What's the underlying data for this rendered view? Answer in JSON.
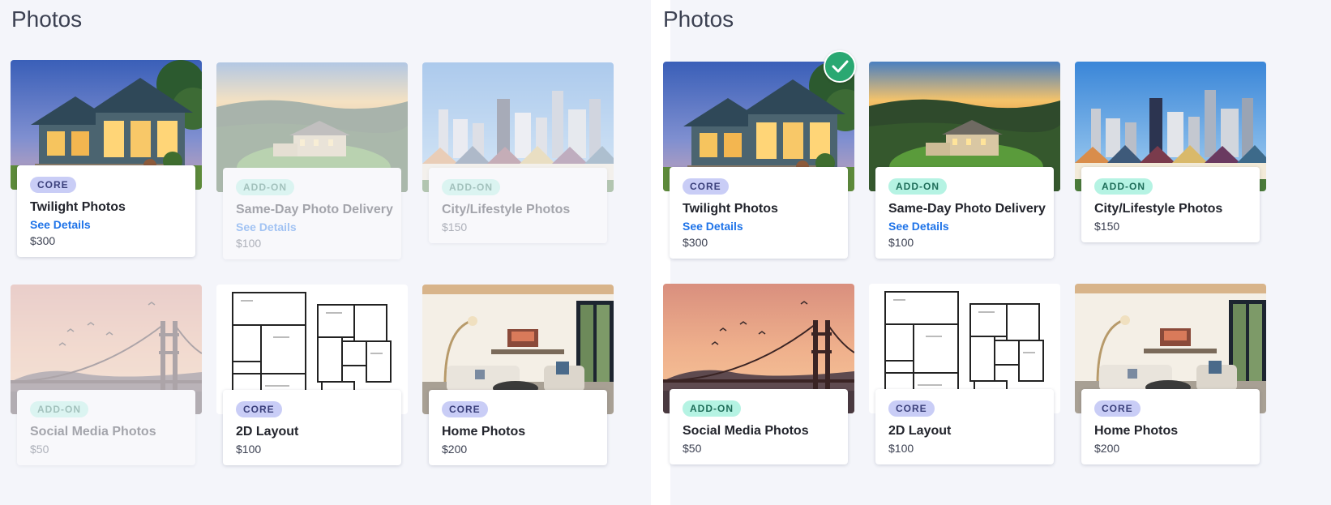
{
  "panels": [
    {
      "title": "Photos",
      "tiles": [
        {
          "badge": "CORE",
          "title": "Twilight Photos",
          "link": "See Details",
          "price": "$300",
          "image": "twilight-house",
          "state": "active"
        },
        {
          "badge": "ADD-ON",
          "title": "Same-Day Photo Delivery",
          "link": "See Details",
          "price": "$100",
          "image": "aerial-estate",
          "state": "disabled"
        },
        {
          "badge": "ADD-ON",
          "title": "City/Lifestyle Photos",
          "link": "",
          "price": "$150",
          "image": "city-skyline",
          "state": "disabled"
        },
        {
          "badge": "ADD-ON",
          "title": "Social Media Photos",
          "link": "",
          "price": "$50",
          "image": "golden-gate-bridge",
          "state": "disabled"
        },
        {
          "badge": "CORE",
          "title": "2D Layout",
          "link": "",
          "price": "$100",
          "image": "floor-plan",
          "state": "active"
        },
        {
          "badge": "CORE",
          "title": "Home Photos",
          "link": "",
          "price": "$200",
          "image": "living-room",
          "state": "active"
        }
      ]
    },
    {
      "title": "Photos",
      "tiles": [
        {
          "badge": "CORE",
          "title": "Twilight Photos",
          "link": "See Details",
          "price": "$300",
          "image": "twilight-house",
          "state": "selected"
        },
        {
          "badge": "ADD-ON",
          "title": "Same-Day Photo Delivery",
          "link": "See Details",
          "price": "$100",
          "image": "aerial-estate",
          "state": "active"
        },
        {
          "badge": "ADD-ON",
          "title": "City/Lifestyle Photos",
          "link": "",
          "price": "$150",
          "image": "city-skyline",
          "state": "active"
        },
        {
          "badge": "ADD-ON",
          "title": "Social Media Photos",
          "link": "",
          "price": "$50",
          "image": "golden-gate-bridge",
          "state": "active"
        },
        {
          "badge": "CORE",
          "title": "2D Layout",
          "link": "",
          "price": "$100",
          "image": "floor-plan",
          "state": "active"
        },
        {
          "badge": "CORE",
          "title": "Home Photos",
          "link": "",
          "price": "$200",
          "image": "living-room",
          "state": "active"
        }
      ]
    }
  ],
  "icons": {
    "selected": "check-icon"
  },
  "colors": {
    "core_badge": "#c9cdf6",
    "addon_badge": "#b5f3e3",
    "link": "#1e73e8",
    "check": "#2aa872"
  }
}
